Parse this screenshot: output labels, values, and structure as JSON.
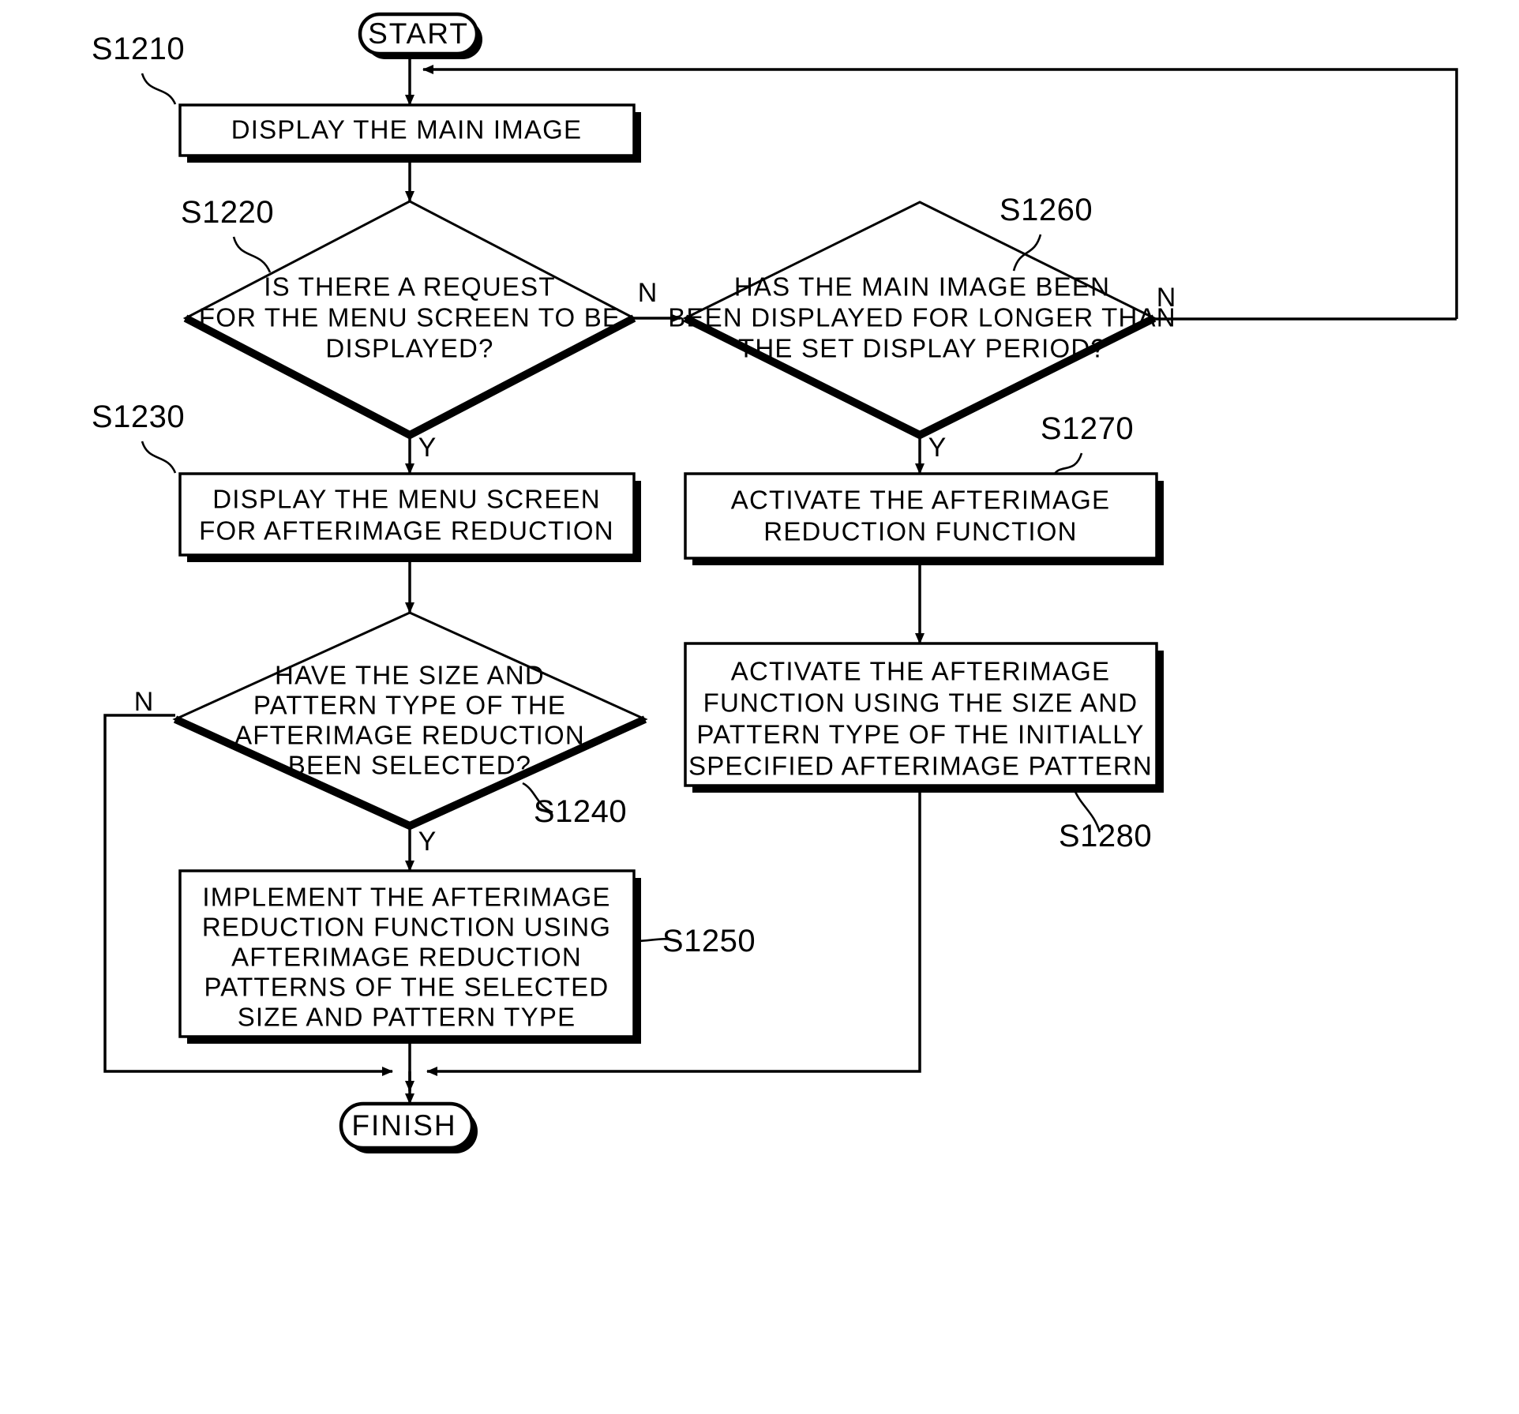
{
  "diagram": {
    "type": "flowchart",
    "terminals": {
      "start": "START",
      "finish": "FINISH"
    },
    "branch_labels": {
      "yes": "Y",
      "no": "N"
    },
    "nodes": [
      {
        "id": "S1210",
        "ref": "S1210",
        "shape": "process",
        "lines": [
          "DISPLAY THE MAIN IMAGE"
        ]
      },
      {
        "id": "S1220",
        "ref": "S1220",
        "shape": "decision",
        "lines": [
          "IS THERE A REQUEST",
          "FOR THE MENU SCREEN TO BE",
          "DISPLAYED?"
        ]
      },
      {
        "id": "S1230",
        "ref": "S1230",
        "shape": "process",
        "lines": [
          "DISPLAY THE MENU SCREEN",
          "FOR AFTERIMAGE REDUCTION"
        ]
      },
      {
        "id": "S1240",
        "ref": "S1240",
        "shape": "decision",
        "lines": [
          "HAVE THE SIZE AND",
          "PATTERN TYPE OF THE",
          "AFTERIMAGE REDUCTION",
          "BEEN SELECTED?"
        ]
      },
      {
        "id": "S1250",
        "ref": "S1250",
        "shape": "process",
        "lines": [
          "IMPLEMENT THE AFTERIMAGE",
          "REDUCTION FUNCTION USING",
          "AFTERIMAGE REDUCTION",
          "PATTERNS OF THE SELECTED",
          "SIZE AND PATTERN TYPE"
        ]
      },
      {
        "id": "S1260",
        "ref": "S1260",
        "shape": "decision",
        "lines": [
          "HAS THE MAIN IMAGE BEEN",
          "BEEN DISPLAYED FOR LONGER THAN",
          "THE SET DISPLAY PERIOD?"
        ]
      },
      {
        "id": "S1270",
        "ref": "S1270",
        "shape": "process",
        "lines": [
          "ACTIVATE THE AFTERIMAGE",
          "REDUCTION FUNCTION"
        ]
      },
      {
        "id": "S1280",
        "ref": "S1280",
        "shape": "process",
        "lines": [
          "ACTIVATE THE AFTERIMAGE",
          "FUNCTION USING THE SIZE AND",
          "PATTERN TYPE OF THE INITIALLY",
          "SPECIFIED AFTERIMAGE PATTERN"
        ]
      }
    ],
    "colors": {
      "stroke": "#000000",
      "fill": "#ffffff",
      "background": "#ffffff"
    }
  }
}
